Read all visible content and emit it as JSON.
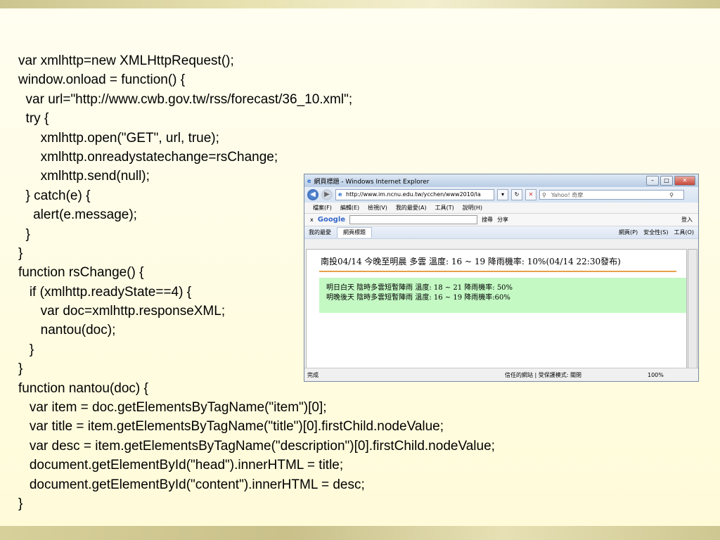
{
  "code_lines": [
    "var xmlhttp=new XMLHttpRequest();",
    "window.onload = function() {",
    "  var url=\"http://www.cwb.gov.tw/rss/forecast/36_10.xml\";",
    "  try {",
    "      xmlhttp.open(\"GET\", url, true);",
    "      xmlhttp.onreadystatechange=rsChange;",
    "      xmlhttp.send(null);",
    "  } catch(e) {",
    "    alert(e.message);",
    "  }",
    "}",
    "function rsChange() {",
    "   if (xmlhttp.readyState==4) {",
    "      var doc=xmlhttp.responseXML;",
    "      nantou(doc);",
    "   }",
    "}",
    "function nantou(doc) {",
    "   var item = doc.getElementsByTagName(\"item\")[0];",
    "   var title = item.getElementsByTagName(\"title\")[0].firstChild.nodeValue;",
    "   var desc = item.getElementsByTagName(\"description\")[0].firstChild.nodeValue;",
    "   document.getElementById(\"head\").innerHTML = title;",
    "   document.getElementById(\"content\").innerHTML = desc;",
    "}"
  ],
  "browser": {
    "title": "網頁標題 - Windows Internet Explorer",
    "url": "http://www.im.ncnu.edu.tw/ycchen/www2010/la",
    "search_placeholder": "Yahoo! 奇摩",
    "menu": [
      "檔案(F)",
      "編輯(E)",
      "檢視(V)",
      "我的最愛(A)",
      "工具(T)",
      "說明(H)"
    ],
    "google_label": "Google",
    "google_search": "搜尋",
    "google_share": "分享",
    "google_login": "登入",
    "favorites": "我的最愛",
    "tab_title": "網頁標題",
    "tools": [
      "網頁(P)",
      "安全性(S)",
      "工具(O)"
    ],
    "page": {
      "headline": "南投04/14 今晚至明晨 多雲 溫度: 16 ~ 19 降雨機率: 10%(04/14 22:30發布)",
      "line1": "明日白天 陰時多雲短暫陣雨 溫度: 18 ~ 21 降雨機率: 50%",
      "line2": "明晚後天 陰時多雲短暫陣雨 溫度: 16 ~ 19 降雨機率:60%"
    },
    "status_done": "完成",
    "status_trust": "信任的網站 | 受保護模式: 關閉",
    "zoom": "100%"
  }
}
